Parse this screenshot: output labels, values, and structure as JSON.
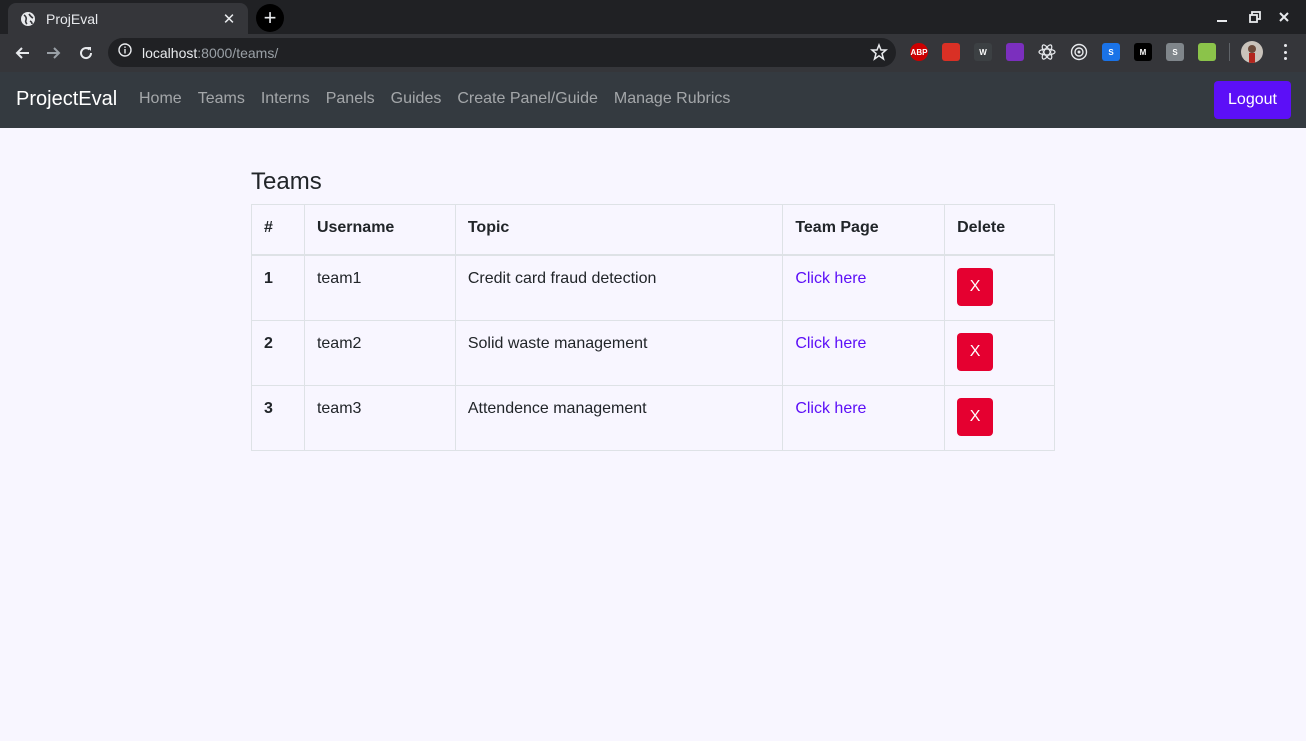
{
  "browser": {
    "tab_title": "ProjEval",
    "url_host": "localhost",
    "url_path": ":8000/teams/",
    "extensions": [
      {
        "name": "abp-extension-icon",
        "label": "ABP",
        "color": "#cc0000"
      },
      {
        "name": "red-extension-icon",
        "label": "",
        "color": "#d93025"
      },
      {
        "name": "w-extension-icon",
        "label": "W",
        "color": "#3c4043"
      },
      {
        "name": "purple-extension-icon",
        "label": "",
        "color": "#7b2fbe"
      },
      {
        "name": "react-extension-icon",
        "label": "",
        "color": "#35363a"
      },
      {
        "name": "target-extension-icon",
        "label": "",
        "color": "#35363a"
      },
      {
        "name": "s-extension-icon",
        "label": "S",
        "color": "#1a73e8"
      },
      {
        "name": "m-extension-icon",
        "label": "M",
        "color": "#000000"
      },
      {
        "name": "gray-s-extension-icon",
        "label": "S",
        "color": "#80868b"
      },
      {
        "name": "green-extension-icon",
        "label": "",
        "color": "#8bc34a"
      }
    ]
  },
  "navbar": {
    "brand": "ProjectEval",
    "links": [
      "Home",
      "Teams",
      "Interns",
      "Panels",
      "Guides",
      "Create Panel/Guide",
      "Manage Rubrics"
    ],
    "logout_label": "Logout",
    "accent_color": "#5c0ff7"
  },
  "main": {
    "title": "Teams",
    "table": {
      "headers": [
        "#",
        "Username",
        "Topic",
        "Team Page",
        "Delete"
      ],
      "rows": [
        {
          "num": "1",
          "username": "team1",
          "topic": "Credit card fraud detection",
          "link": "Click here",
          "delete": "X"
        },
        {
          "num": "2",
          "username": "team2",
          "topic": "Solid waste management",
          "link": "Click here",
          "delete": "X"
        },
        {
          "num": "3",
          "username": "team3",
          "topic": "Attendence management",
          "link": "Click here",
          "delete": "X"
        }
      ]
    },
    "delete_color": "#e50030"
  }
}
